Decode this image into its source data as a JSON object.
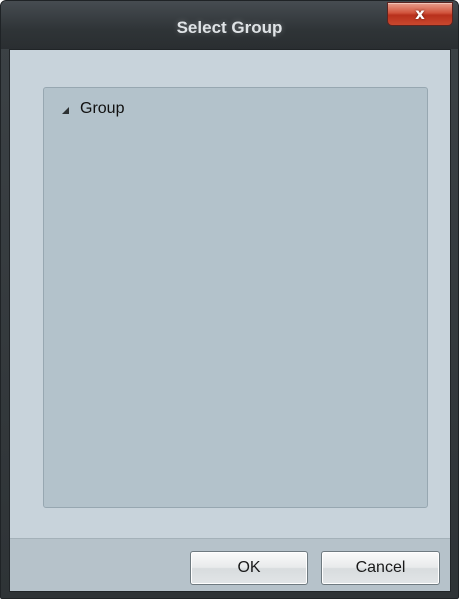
{
  "window": {
    "title": "Select Group",
    "close_glyph": "x"
  },
  "tree": {
    "items": [
      {
        "label": "Group",
        "icon": "expanded-triangle-icon",
        "expanded": true
      }
    ]
  },
  "buttons": {
    "ok_label": "OK",
    "cancel_label": "Cancel"
  },
  "colors": {
    "title_bar": "#2f3437",
    "close_button": "#c9482e",
    "client_background": "#c8d3db",
    "tree_background": "#b3c2cb",
    "footer_background": "#b6c2ca"
  }
}
